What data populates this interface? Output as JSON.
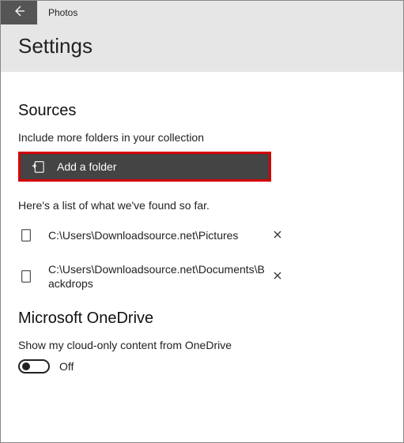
{
  "app": {
    "title": "Photos"
  },
  "page": {
    "title": "Settings"
  },
  "sources": {
    "heading": "Sources",
    "include_text": "Include more folders in your collection",
    "add_folder_label": "Add a folder",
    "list_caption": "Here's a list of what we've found so far.",
    "folders": [
      {
        "path": "C:\\Users\\Downloadsource.net\\Pictures"
      },
      {
        "path": "C:\\Users\\Downloadsource.net\\Documents\\Backdrops"
      }
    ]
  },
  "onedrive": {
    "heading": "Microsoft OneDrive",
    "description": "Show my cloud-only content from OneDrive",
    "toggle_state": "Off"
  }
}
